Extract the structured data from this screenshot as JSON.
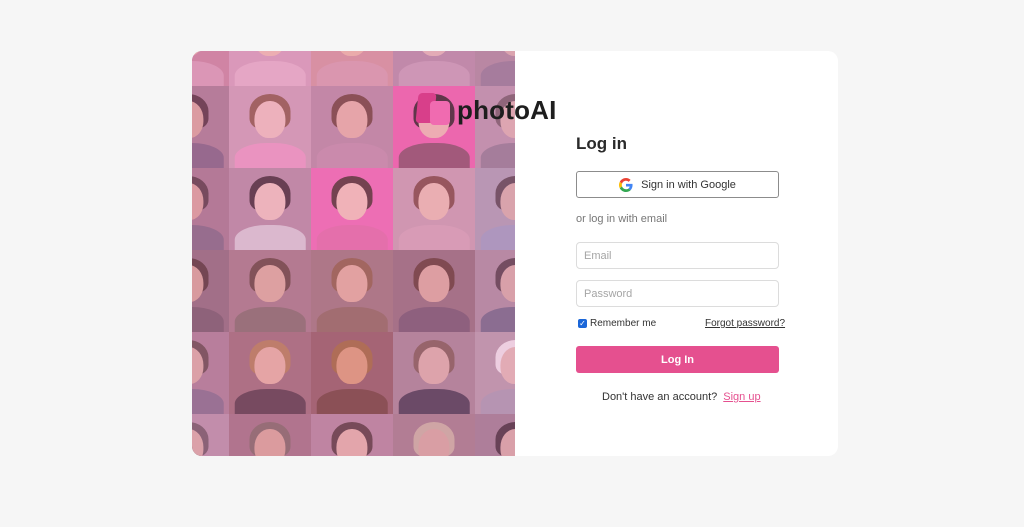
{
  "brand": {
    "name": "photoAI",
    "colors": {
      "accent": "#e5508f",
      "logo_back": "#d83f8a",
      "logo_front": "#f06bb0"
    }
  },
  "login": {
    "title": "Log in",
    "google_button_label": "Sign in with Google",
    "divider_text": "or log in with email",
    "email_placeholder": "Email",
    "password_placeholder": "Password",
    "remember_label": "Remember me",
    "remember_checked": true,
    "forgot_link": "Forgot password?",
    "submit_label": "Log In",
    "no_account_text": "Don't have an account?",
    "signup_link": "Sign up"
  },
  "mosaic": {
    "tiles": [
      {
        "bg": "#c98a9f",
        "skin": "#e8b8a8",
        "hair": "#7a5240",
        "shirt": "#d9a2b8"
      },
      {
        "bg": "#d7a6bd",
        "skin": "#f0c4b2",
        "hair": "#8c6a4c",
        "shirt": "#e7b9cc"
      },
      {
        "bg": "#d59a9d",
        "skin": "#edc0a8",
        "hair": "#6e4632",
        "shirt": "#d7a2ad"
      },
      {
        "bg": "#b591a7",
        "skin": "#e4c0b8",
        "hair": "#a8a0a8",
        "shirt": "#c6a3b8"
      },
      {
        "bg": "#a98e9d",
        "skin": "#d8b6ae",
        "hair": "#5a4b4e",
        "shirt": "#8f7f95"
      },
      {
        "bg": "#a57e91",
        "skin": "#d8aa9a",
        "hair": "#4a3036",
        "shirt": "#7b6480"
      },
      {
        "bg": "#cfa4b8",
        "skin": "#f2c8c0",
        "hair": "#8a5a44",
        "shirt": "#ee9ec5"
      },
      {
        "bg": "#b78ea3",
        "skin": "#e8b6a5",
        "hair": "#6a4234",
        "shirt": "#c192a9"
      },
      {
        "bg": "#f062ac",
        "skin": "#f2c1b3",
        "hair": "#2f1e22",
        "shirt": "#8a4e66"
      },
      {
        "bg": "#b89aac",
        "skin": "#dcb8b0",
        "hair": "#6f5f65",
        "shirt": "#8e8092"
      },
      {
        "bg": "#a37a8c",
        "skin": "#d8a79a",
        "hair": "#4e3a3e",
        "shirt": "#7a6a80"
      },
      {
        "bg": "#b48fa3",
        "skin": "#f2cbc0",
        "hair": "#3a2a2e",
        "shirt": "#d8d2d8"
      },
      {
        "bg": "#f26bb4",
        "skin": "#f5c9ba",
        "hair": "#4a2e2a",
        "shirt": "#e56da8"
      },
      {
        "bg": "#c9a3b0",
        "skin": "#eec4b2",
        "hair": "#7a4a3e",
        "shirt": "#d4aab8"
      },
      {
        "bg": "#a9a3b5",
        "skin": "#d6b4aa",
        "hair": "#50464c",
        "shirt": "#9aa2c2"
      },
      {
        "bg": "#8a6c78",
        "skin": "#d4a896",
        "hair": "#4a342e",
        "shirt": "#6e5a64"
      },
      {
        "bg": "#a37c84",
        "skin": "#dcb09a",
        "hair": "#5e4436",
        "shirt": "#7e6e66"
      },
      {
        "bg": "#9a7878",
        "skin": "#e2b29a",
        "hair": "#8a6040",
        "shirt": "#8a6a58"
      },
      {
        "bg": "#8f6f78",
        "skin": "#dcae9c",
        "hair": "#5a3a2c",
        "shirt": "#6e586a"
      },
      {
        "bg": "#a8909e",
        "skin": "#d4b0a6",
        "hair": "#4a3e42",
        "shirt": "#6a6a84"
      },
      {
        "bg": "#a88294",
        "skin": "#d8b0a2",
        "hair": "#5e4a46",
        "shirt": "#7e7088"
      },
      {
        "bg": "#9a6e74",
        "skin": "#e6b6a0",
        "hair": "#b08050",
        "shirt": "#4e3a40"
      },
      {
        "bg": "#8e5e5e",
        "skin": "#dca072",
        "hair": "#9c6a34",
        "shirt": "#6a4232"
      },
      {
        "bg": "#a48894",
        "skin": "#dcb4a8",
        "hair": "#7a5e50",
        "shirt": "#3e3a4a"
      },
      {
        "bg": "#b5a0ab",
        "skin": "#e2c0b6",
        "hair": "#f2f0f2",
        "shirt": "#a6a0b2"
      },
      {
        "bg": "#b696a8",
        "skin": "#d8b2a6",
        "hair": "#6a5a60",
        "shirt": "#8a96b0"
      },
      {
        "bg": "#9e7480",
        "skin": "#d8aa96",
        "hair": "#7a6a60",
        "shirt": "#5e4e5a"
      },
      {
        "bg": "#b28a9c",
        "skin": "#e4b8a8",
        "hair": "#4e3a36",
        "shirt": "#8a7484"
      },
      {
        "bg": "#a08088",
        "skin": "#d6ae9e",
        "hair": "#c8b8a0",
        "shirt": "#6e5e6a"
      },
      {
        "bg": "#9a8290",
        "skin": "#d6b0a6",
        "hair": "#3a2e34",
        "shirt": "#5e5a6e"
      }
    ]
  }
}
